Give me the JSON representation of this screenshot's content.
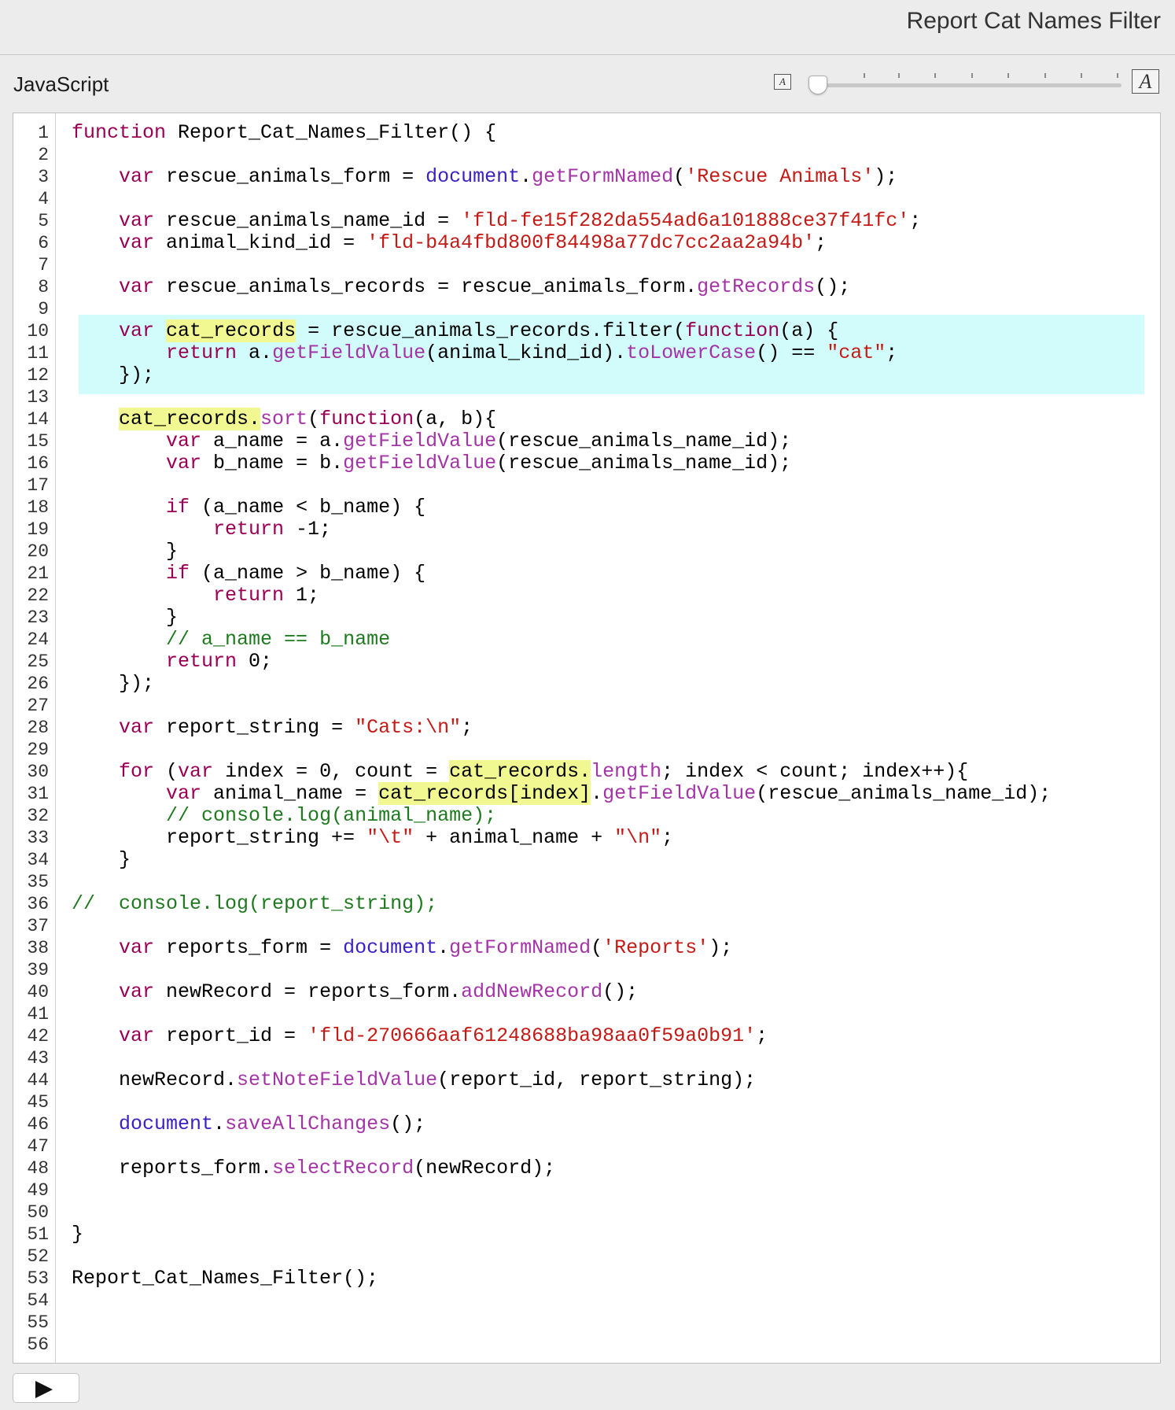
{
  "window": {
    "title": "Report Cat Names Filter"
  },
  "toolbar": {
    "language_label": "JavaScript",
    "font_small_glyph": "A",
    "font_large_glyph": "A",
    "font_size_level": 0
  },
  "editor": {
    "line_numbers": [
      "1",
      "2",
      "3",
      "4",
      "5",
      "6",
      "7",
      "8",
      "9",
      "10",
      "11",
      "12",
      "13",
      "14",
      "15",
      "16",
      "17",
      "18",
      "19",
      "20",
      "21",
      "22",
      "23",
      "24",
      "25",
      "26",
      "27",
      "28",
      "29",
      "30",
      "31",
      "32",
      "33",
      "34",
      "35",
      "36",
      "37",
      "38",
      "39",
      "40",
      "41",
      "42",
      "43",
      "44",
      "45",
      "46",
      "47",
      "48",
      "49",
      "50",
      "51",
      "52",
      "53",
      "54",
      "55",
      "56"
    ],
    "lines": [
      [
        {
          "t": "kw",
          "s": "function"
        },
        {
          "t": "p",
          "s": " Report_Cat_Names_Filter() {"
        }
      ],
      [],
      [
        {
          "t": "p",
          "s": "    "
        },
        {
          "t": "kw",
          "s": "var"
        },
        {
          "t": "p",
          "s": " rescue_animals_form = "
        },
        {
          "t": "doc",
          "s": "document"
        },
        {
          "t": "p",
          "s": "."
        },
        {
          "t": "fn",
          "s": "getFormNamed"
        },
        {
          "t": "p",
          "s": "("
        },
        {
          "t": "str",
          "s": "'Rescue Animals'"
        },
        {
          "t": "p",
          "s": ");"
        }
      ],
      [],
      [
        {
          "t": "p",
          "s": "    "
        },
        {
          "t": "kw",
          "s": "var"
        },
        {
          "t": "p",
          "s": " rescue_animals_name_id = "
        },
        {
          "t": "str",
          "s": "'fld-fe15f282da554ad6a101888ce37f41fc'"
        },
        {
          "t": "p",
          "s": ";"
        }
      ],
      [
        {
          "t": "p",
          "s": "    "
        },
        {
          "t": "kw",
          "s": "var"
        },
        {
          "t": "p",
          "s": " animal_kind_id = "
        },
        {
          "t": "str",
          "s": "'fld-b4a4fbd800f84498a77dc7cc2aa2a94b'"
        },
        {
          "t": "p",
          "s": ";"
        }
      ],
      [],
      [
        {
          "t": "p",
          "s": "    "
        },
        {
          "t": "kw",
          "s": "var"
        },
        {
          "t": "p",
          "s": " rescue_animals_records = rescue_animals_form."
        },
        {
          "t": "fn",
          "s": "getRecords"
        },
        {
          "t": "p",
          "s": "();"
        }
      ],
      [],
      [
        {
          "t": "p",
          "s": "    "
        },
        {
          "t": "kw",
          "s": "var"
        },
        {
          "t": "p",
          "s": " "
        },
        {
          "t": "hl",
          "s": "cat_records"
        },
        {
          "t": "p",
          "s": " = rescue_animals_records.filter("
        },
        {
          "t": "kw",
          "s": "function"
        },
        {
          "t": "p",
          "s": "(a) {"
        }
      ],
      [
        {
          "t": "p",
          "s": "        "
        },
        {
          "t": "kw",
          "s": "return"
        },
        {
          "t": "p",
          "s": " a."
        },
        {
          "t": "fn",
          "s": "getFieldValue"
        },
        {
          "t": "p",
          "s": "(animal_kind_id)."
        },
        {
          "t": "fn",
          "s": "toLowerCase"
        },
        {
          "t": "p",
          "s": "() == "
        },
        {
          "t": "str",
          "s": "\"cat\""
        },
        {
          "t": "p",
          "s": ";"
        }
      ],
      [
        {
          "t": "p",
          "s": "    });"
        }
      ],
      [],
      [
        {
          "t": "p",
          "s": "    "
        },
        {
          "t": "hl",
          "s": "cat_records."
        },
        {
          "t": "fn",
          "s": "sort"
        },
        {
          "t": "p",
          "s": "("
        },
        {
          "t": "kw",
          "s": "function"
        },
        {
          "t": "p",
          "s": "(a, b){"
        }
      ],
      [
        {
          "t": "p",
          "s": "        "
        },
        {
          "t": "kw",
          "s": "var"
        },
        {
          "t": "p",
          "s": " a_name = a."
        },
        {
          "t": "fn",
          "s": "getFieldValue"
        },
        {
          "t": "p",
          "s": "(rescue_animals_name_id);"
        }
      ],
      [
        {
          "t": "p",
          "s": "        "
        },
        {
          "t": "kw",
          "s": "var"
        },
        {
          "t": "p",
          "s": " b_name = b."
        },
        {
          "t": "fn",
          "s": "getFieldValue"
        },
        {
          "t": "p",
          "s": "(rescue_animals_name_id);"
        }
      ],
      [],
      [
        {
          "t": "p",
          "s": "        "
        },
        {
          "t": "kw",
          "s": "if"
        },
        {
          "t": "p",
          "s": " (a_name < b_name) {"
        }
      ],
      [
        {
          "t": "p",
          "s": "            "
        },
        {
          "t": "kw",
          "s": "return"
        },
        {
          "t": "p",
          "s": " -1;"
        }
      ],
      [
        {
          "t": "p",
          "s": "        }"
        }
      ],
      [
        {
          "t": "p",
          "s": "        "
        },
        {
          "t": "kw",
          "s": "if"
        },
        {
          "t": "p",
          "s": " (a_name > b_name) {"
        }
      ],
      [
        {
          "t": "p",
          "s": "            "
        },
        {
          "t": "kw",
          "s": "return"
        },
        {
          "t": "p",
          "s": " 1;"
        }
      ],
      [
        {
          "t": "p",
          "s": "        }"
        }
      ],
      [
        {
          "t": "p",
          "s": "        "
        },
        {
          "t": "cm",
          "s": "// a_name == b_name"
        }
      ],
      [
        {
          "t": "p",
          "s": "        "
        },
        {
          "t": "kw",
          "s": "return"
        },
        {
          "t": "p",
          "s": " 0;"
        }
      ],
      [
        {
          "t": "p",
          "s": "    });"
        }
      ],
      [],
      [
        {
          "t": "p",
          "s": "    "
        },
        {
          "t": "kw",
          "s": "var"
        },
        {
          "t": "p",
          "s": " report_string = "
        },
        {
          "t": "str",
          "s": "\"Cats:\\n\""
        },
        {
          "t": "p",
          "s": ";"
        }
      ],
      [],
      [
        {
          "t": "p",
          "s": "    "
        },
        {
          "t": "kw",
          "s": "for"
        },
        {
          "t": "p",
          "s": " ("
        },
        {
          "t": "kw",
          "s": "var"
        },
        {
          "t": "p",
          "s": " index = 0, count = "
        },
        {
          "t": "hl",
          "s": "cat_records."
        },
        {
          "t": "fn",
          "s": "length"
        },
        {
          "t": "p",
          "s": "; index < count; index++){"
        }
      ],
      [
        {
          "t": "p",
          "s": "        "
        },
        {
          "t": "kw",
          "s": "var"
        },
        {
          "t": "p",
          "s": " animal_name = "
        },
        {
          "t": "hl",
          "s": "cat_records[index]"
        },
        {
          "t": "p",
          "s": "."
        },
        {
          "t": "fn",
          "s": "getFieldValue"
        },
        {
          "t": "p",
          "s": "(rescue_animals_name_id);"
        }
      ],
      [
        {
          "t": "p",
          "s": "        "
        },
        {
          "t": "cm",
          "s": "// console.log(animal_name);"
        }
      ],
      [
        {
          "t": "p",
          "s": "        report_string += "
        },
        {
          "t": "str",
          "s": "\"\\t\""
        },
        {
          "t": "p",
          "s": " + animal_name + "
        },
        {
          "t": "str",
          "s": "\"\\n\""
        },
        {
          "t": "p",
          "s": ";"
        }
      ],
      [
        {
          "t": "p",
          "s": "    }"
        }
      ],
      [],
      [
        {
          "t": "cm",
          "s": "//  console.log(report_string);"
        }
      ],
      [],
      [
        {
          "t": "p",
          "s": "    "
        },
        {
          "t": "kw",
          "s": "var"
        },
        {
          "t": "p",
          "s": " reports_form = "
        },
        {
          "t": "doc",
          "s": "document"
        },
        {
          "t": "p",
          "s": "."
        },
        {
          "t": "fn",
          "s": "getFormNamed"
        },
        {
          "t": "p",
          "s": "("
        },
        {
          "t": "str",
          "s": "'Reports'"
        },
        {
          "t": "p",
          "s": ");"
        }
      ],
      [],
      [
        {
          "t": "p",
          "s": "    "
        },
        {
          "t": "kw",
          "s": "var"
        },
        {
          "t": "p",
          "s": " newRecord = reports_form."
        },
        {
          "t": "fn",
          "s": "addNewRecord"
        },
        {
          "t": "p",
          "s": "();"
        }
      ],
      [],
      [
        {
          "t": "p",
          "s": "    "
        },
        {
          "t": "kw",
          "s": "var"
        },
        {
          "t": "p",
          "s": " report_id = "
        },
        {
          "t": "str",
          "s": "'fld-270666aaf61248688ba98aa0f59a0b91'"
        },
        {
          "t": "p",
          "s": ";"
        }
      ],
      [],
      [
        {
          "t": "p",
          "s": "    newRecord."
        },
        {
          "t": "fn",
          "s": "setNoteFieldValue"
        },
        {
          "t": "p",
          "s": "(report_id, report_string);"
        }
      ],
      [],
      [
        {
          "t": "p",
          "s": "    "
        },
        {
          "t": "doc",
          "s": "document"
        },
        {
          "t": "p",
          "s": "."
        },
        {
          "t": "fn",
          "s": "saveAllChanges"
        },
        {
          "t": "p",
          "s": "();"
        }
      ],
      [],
      [
        {
          "t": "p",
          "s": "    reports_form."
        },
        {
          "t": "fn",
          "s": "selectRecord"
        },
        {
          "t": "p",
          "s": "(newRecord);"
        }
      ],
      [],
      [],
      [
        {
          "t": "p",
          "s": "}"
        }
      ],
      [],
      [
        {
          "t": "p",
          "s": "Report_Cat_Names_Filter();"
        }
      ],
      [],
      [],
      []
    ],
    "selected_lines": [
      10,
      12
    ],
    "colors": {
      "keyword": "#990055",
      "string": "#c41a16",
      "document": "#3b20c4",
      "method": "#a433a8",
      "comment": "#1e7a1e",
      "selection": "#d2fcfc",
      "match_highlight": "#f1f891"
    }
  },
  "run_button": {
    "icon": "play-icon"
  }
}
